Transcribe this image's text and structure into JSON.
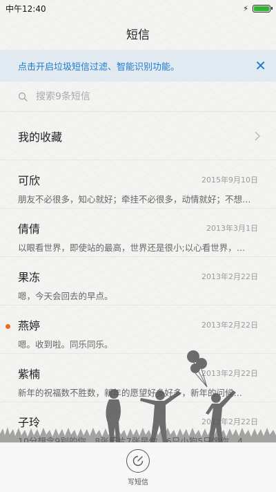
{
  "status_bar": {
    "time": "中午12:40"
  },
  "header": {
    "title": "短信"
  },
  "banner": {
    "text": "点击开启垃圾短信过滤、智能识别功能。"
  },
  "search": {
    "placeholder": "搜索9条短信"
  },
  "favorites": {
    "label": "我的收藏"
  },
  "conversations": [
    {
      "name": "可欣",
      "date": "2015年9月10日",
      "preview": "朋友不必很多，知心就好；牵挂不必很多，动情就好；不想…",
      "unread": false
    },
    {
      "name": "倩倩",
      "date": "2013年3月1日",
      "preview": "以眼看世界，即使站的最高，世界还是很小;以心看世界，…",
      "unread": false
    },
    {
      "name": "果冻",
      "date": "2013年2月22日",
      "preview": "嗯，今天会回去的早点。",
      "unread": false
    },
    {
      "name": "燕婷",
      "date": "2013年2月22日",
      "preview": "嗯。收到啦。同乐同乐。",
      "unread": true
    },
    {
      "name": "紫楠",
      "date": "2013年2月22日",
      "preview": "新年的祝福数不胜数，新年的愿望好多好多，新年的问候…",
      "unread": false
    },
    {
      "name": "子玲",
      "date": "2013年2月22日",
      "preview": "10分想念9别的你，8张照片7张是你，6只小狗5只像你，4…",
      "unread": false
    }
  ],
  "bottom_bar": {
    "compose_label": "写短信"
  },
  "colors": {
    "accent": "#1e7ad0",
    "unread_dot": "#f26522",
    "battery": "#2fb52f"
  }
}
